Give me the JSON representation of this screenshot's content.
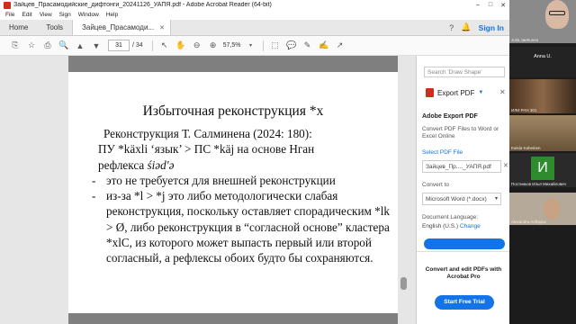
{
  "window": {
    "title": "Зайцев_Прасамодийские_дифтонги_20241126_УАПЯ.pdf - Adobe Acrobat Reader (64-bit)",
    "minimize": "–",
    "maximize": "□",
    "close": "✕"
  },
  "menu": [
    "File",
    "Edit",
    "View",
    "Sign",
    "Window",
    "Help"
  ],
  "tabs": {
    "home": "Home",
    "tools": "Tools",
    "document": "Зайцев_Прасамоди...",
    "document_close": "✕",
    "signin": "Sign In"
  },
  "toolbar": {
    "page_current": "31",
    "page_total": "/ 34",
    "zoom": "57,5%"
  },
  "slide": {
    "title": "Избыточная реконструкция *х",
    "line1": "Реконструкция Т. Салминена (2024: 180):",
    "line2": "ПУ *käxli ‘язык’ > ПС *käj на основе Нган",
    "line3_prefix": "рефлекса ",
    "line3_italic": "śiəd'ə",
    "bullets": [
      {
        "marker": "-",
        "text": "это не требуется для внешней реконструкции"
      },
      {
        "marker": "-",
        "text": "из-за *l > *j это либо методологически слабая реконструкция, поскольку оставляет спорадическим *lk > Ø, либо реконструкция в “согласной основе” кластера *xlC, из которого может выпасть первый или второй согласный, а рефлексы обоих будто бы сохраняются."
      }
    ]
  },
  "right_pane": {
    "search_placeholder": "Search 'Draw Shape'",
    "export_button": "Export PDF",
    "export_heading": "Adobe Export PDF",
    "export_desc": "Convert PDF Files to Word or Excel Online",
    "select_link": "Select PDF File",
    "file_name": "Зайцев_Пр...._УАПЯ.pdf",
    "convert_label": "Convert to",
    "convert_value": "Microsoft Word (*.docx)",
    "language_label": "Document Language:",
    "language_value": "English (U.S.)",
    "language_change": "Change",
    "promo_text": "Convert and edit PDFs with Acrobat Pro",
    "trial_button": "Start Free Trial"
  },
  "participants": [
    {
      "name": "Julia Jaehunen"
    },
    {
      "name": "Anna U."
    },
    {
      "name": "ИЛИ РАН 301"
    },
    {
      "name": "Kaisla Kaheinen"
    },
    {
      "name": "Постников Илья Михайлович",
      "avatar_letter": "И"
    },
    {
      "name": "Alexandra Arkhipov"
    }
  ],
  "colors": {
    "accent": "#1473e6",
    "acrobat_red": "#d42b1e",
    "slide_band": "#7f7f7f"
  }
}
